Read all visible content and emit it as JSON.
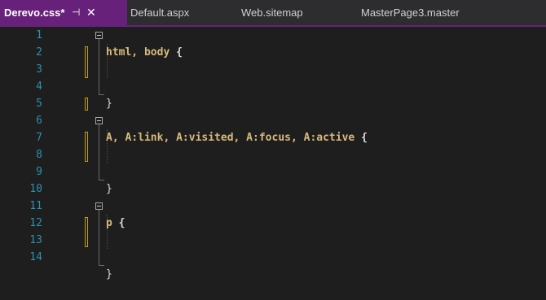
{
  "tabs": {
    "active": {
      "label": "Derevo.css*",
      "pin": "⊣",
      "close": "✕"
    },
    "others": [
      "Default.aspx",
      "Web.sitemap",
      "MasterPage3.master"
    ]
  },
  "editor": {
    "lines": [
      {
        "n": "1"
      },
      {
        "n": "2"
      },
      {
        "n": "3"
      },
      {
        "n": "4"
      },
      {
        "n": "5"
      },
      {
        "n": "6"
      },
      {
        "n": "7"
      },
      {
        "n": "8"
      },
      {
        "n": "9"
      },
      {
        "n": "10"
      },
      {
        "n": "11"
      },
      {
        "n": "12"
      },
      {
        "n": "13"
      },
      {
        "n": "14"
      }
    ],
    "rules": [
      {
        "selector": "html, body",
        "open": " {",
        "close": "}"
      },
      {
        "selector": "A, A:link, A:visited, A:focus, A:active",
        "open": " {",
        "close": "}"
      },
      {
        "selector": "p",
        "open": " {",
        "close": "}"
      }
    ]
  }
}
